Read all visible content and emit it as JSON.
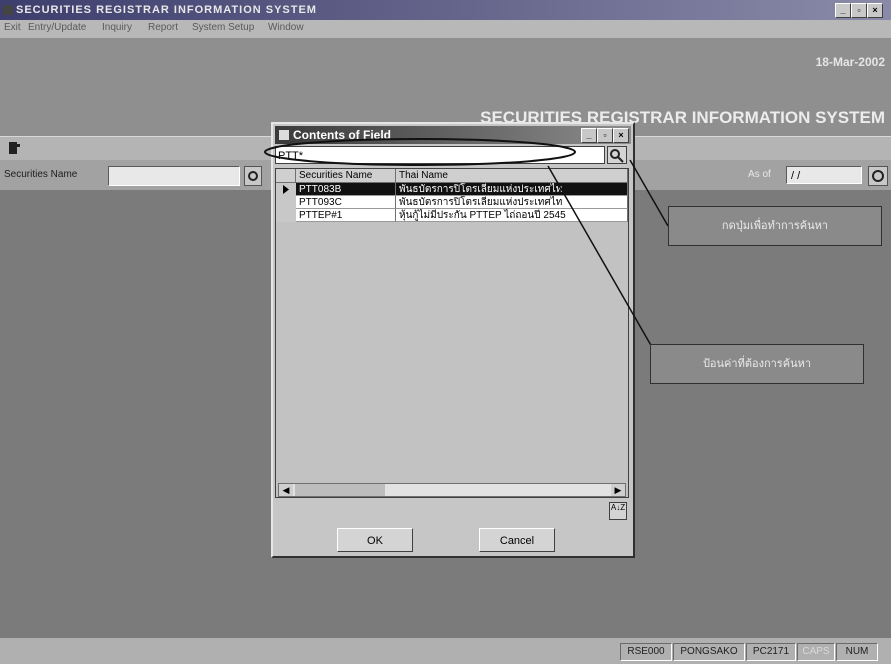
{
  "window": {
    "title": "SECURITIES REGISTRAR INFORMATION SYSTEM",
    "minimize": "_",
    "restore": "▫",
    "close": "×"
  },
  "menu": [
    "Exit",
    "Entry/Update",
    "Inquiry",
    "Report",
    "System Setup",
    "Window"
  ],
  "banner": {
    "date": "18-Mar-2002",
    "app_title": "SECURITIES REGISTRAR INFORMATION SYSTEM"
  },
  "search_form": {
    "securities_label": "Securities Name",
    "asof_label": "As of",
    "asof_value": "/ /"
  },
  "dialog": {
    "title": "Contents of Field",
    "search_value": "PTT*",
    "columns": [
      "Securities Name",
      "Thai Name"
    ],
    "rows": [
      [
        "PTT083B",
        "พันธบัตรการปิโตรเลียมแห่งประเทศไท"
      ],
      [
        "PTT093C",
        "พันธบัตรการปิโตรเลียมแห่งประเทศไท"
      ],
      [
        "PTTEP#1",
        "หุ้นกู้ไม่มีประกัน PTTEP ไถ่ถอนปี 2545"
      ]
    ],
    "selected_row": 0,
    "sort_label": "A↓Z",
    "ok_label": "OK",
    "cancel_label": "Cancel"
  },
  "callouts": {
    "search_button_hint": "กดปุ่มเพื่อทำการค้นหา",
    "input_hint": "ป้อนค่าที่ต้องการค้นหา"
  },
  "status": [
    "RSE000",
    "PONGSAKO",
    "PC2171",
    "CAPS",
    "NUM"
  ],
  "colors": {
    "selected_row_bg": "#111111",
    "title_bar": "#3e3e6e"
  }
}
